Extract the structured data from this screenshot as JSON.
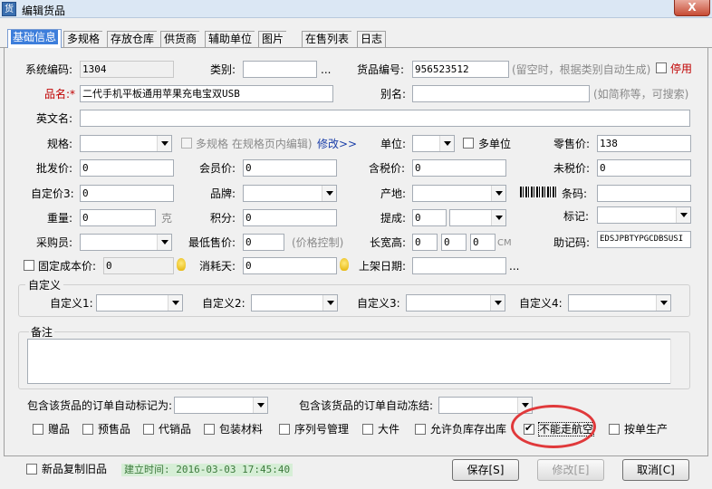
{
  "window": {
    "title": "编辑货品",
    "close_label": "X",
    "icon_text": "货"
  },
  "tabs": [
    {
      "label": "基础信息"
    },
    {
      "label": "多规格"
    },
    {
      "label": "存放仓库"
    },
    {
      "label": "供货商"
    },
    {
      "label": "辅助单位"
    },
    {
      "label": "图片"
    },
    {
      "label": "在售列表"
    },
    {
      "label": "日志"
    }
  ],
  "fields": {
    "system_code": {
      "label": "系统编码:",
      "value": "1304"
    },
    "category": {
      "label": "类别:",
      "value": "",
      "more": "..."
    },
    "item_no": {
      "label": "货品编号:",
      "value": "956523512",
      "hint": "(留空时，根据类别自动生成)",
      "disabled_label": "停用"
    },
    "name": {
      "label": "品名:*",
      "value": "二代手机平板通用苹果充电宝双USB"
    },
    "alias": {
      "label": "别名:",
      "value": "",
      "hint": "(如简称等，可搜索)"
    },
    "english_name": {
      "label": "英文名:",
      "value": ""
    },
    "spec": {
      "label": "规格:",
      "value": "",
      "multi_spec": "多规格 在规格页内编辑)",
      "modify": "修改>>"
    },
    "unit": {
      "label": "单位:",
      "value": "",
      "multi_unit": "多单位"
    },
    "retail_price": {
      "label": "零售价:",
      "value": "138"
    },
    "wholesale_price": {
      "label": "批发价:",
      "value": "0"
    },
    "member_price": {
      "label": "会员价:",
      "value": "0"
    },
    "tax_price": {
      "label": "含税价:",
      "value": "0"
    },
    "no_tax_price": {
      "label": "未税价:",
      "value": "0"
    },
    "custom_price3": {
      "label": "自定价3:",
      "value": "0"
    },
    "brand": {
      "label": "品牌:",
      "value": ""
    },
    "origin": {
      "label": "产地:",
      "value": ""
    },
    "barcode": {
      "label": "条码:",
      "value": ""
    },
    "weight": {
      "label": "重量:",
      "value": "0",
      "unit": "克"
    },
    "points": {
      "label": "积分:",
      "value": "0"
    },
    "commission": {
      "label": "提成:",
      "value": "0",
      "value2": ""
    },
    "mark": {
      "label": "标记:",
      "value": ""
    },
    "buyer": {
      "label": "采购员:",
      "value": ""
    },
    "min_price": {
      "label": "最低售价:",
      "value": "0",
      "hint": "(价格控制)"
    },
    "dimensions": {
      "label": "长宽高:",
      "l": "0",
      "w": "0",
      "h": "0",
      "unit": "CM"
    },
    "mnemonic": {
      "label": "助记码:",
      "value": "EDSJPBTYPGCDBSUSI"
    },
    "fixed_cost": {
      "label": "固定成本价:",
      "value": "0"
    },
    "consume_days": {
      "label": "消耗天:",
      "value": "0"
    },
    "shelf_date": {
      "label": "上架日期:",
      "value": "",
      "more": "..."
    }
  },
  "custom": {
    "title": "自定义",
    "items": [
      {
        "label": "自定义1:",
        "value": ""
      },
      {
        "label": "自定义2:",
        "value": ""
      },
      {
        "label": "自定义3:",
        "value": ""
      },
      {
        "label": "自定义4:",
        "value": ""
      }
    ]
  },
  "notes": {
    "title": "备注",
    "value": ""
  },
  "order_auto_mark": {
    "label": "包含该货品的订单自动标记为:",
    "value": ""
  },
  "order_auto_freeze": {
    "label": "包含该货品的订单自动冻结:",
    "value": ""
  },
  "flags": [
    {
      "label": "赠品",
      "checked": false
    },
    {
      "label": "预售品",
      "checked": false
    },
    {
      "label": "代销品",
      "checked": false
    },
    {
      "label": "包装材料",
      "checked": false
    },
    {
      "label": "序列号管理",
      "checked": false
    },
    {
      "label": "大件",
      "checked": false
    },
    {
      "label": "允许负库存出库",
      "checked": false
    },
    {
      "label": "不能走航空",
      "checked": true
    },
    {
      "label": "按单生产",
      "checked": false
    }
  ],
  "footer": {
    "copy_label": "新品复制旧品",
    "created": "建立时间: 2016-03-03 17:45:40",
    "save": "保存[S]",
    "modify": "修改[E]",
    "cancel": "取消[C]"
  }
}
